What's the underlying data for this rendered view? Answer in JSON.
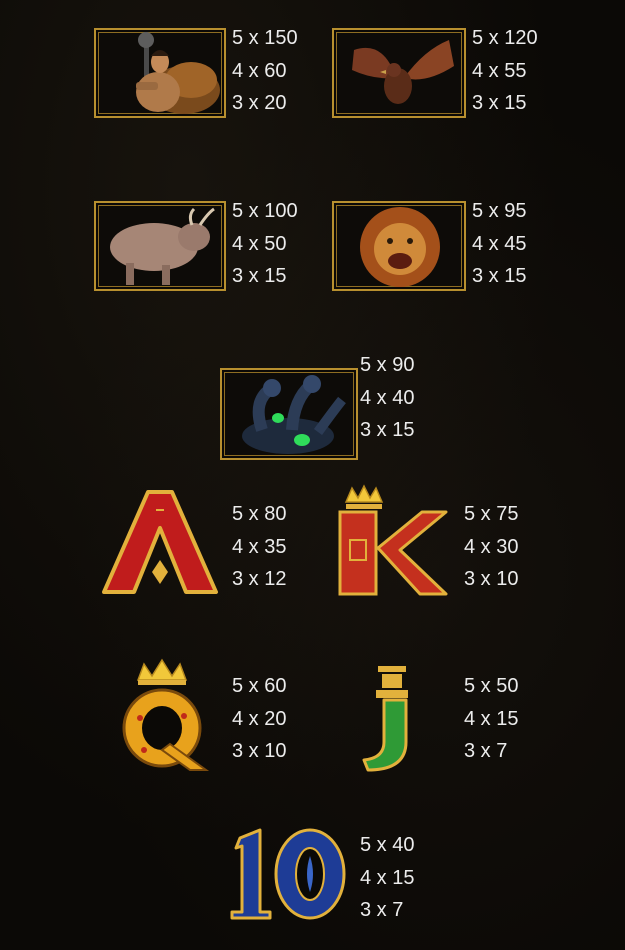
{
  "paytable": [
    {
      "symbol": "hercules",
      "pays": [
        "5 x 150",
        "4 x 60",
        "3 x 20"
      ]
    },
    {
      "symbol": "eagle",
      "pays": [
        "5 x 120",
        "4 x 55",
        "3 x 15"
      ]
    },
    {
      "symbol": "bull",
      "pays": [
        "5 x 100",
        "4 x 50",
        "3 x 15"
      ]
    },
    {
      "symbol": "lion",
      "pays": [
        "5 x 95",
        "4 x 45",
        "3 x 15"
      ]
    },
    {
      "symbol": "hydra",
      "pays": [
        "5 x 90",
        "4 x 40",
        "3 x 15"
      ]
    },
    {
      "symbol": "A",
      "pays": [
        "5 x 80",
        "4 x 35",
        "3 x 12"
      ]
    },
    {
      "symbol": "K",
      "pays": [
        "5 x 75",
        "4 x 30",
        "3 x 10"
      ]
    },
    {
      "symbol": "Q",
      "pays": [
        "5 x 60",
        "4 x 20",
        "3 x 10"
      ]
    },
    {
      "symbol": "J",
      "pays": [
        "5 x 50",
        "4 x 15",
        "3 x 7"
      ]
    },
    {
      "symbol": "10",
      "pays": [
        "5 x 40",
        "4 x 15",
        "3 x 7"
      ]
    }
  ]
}
